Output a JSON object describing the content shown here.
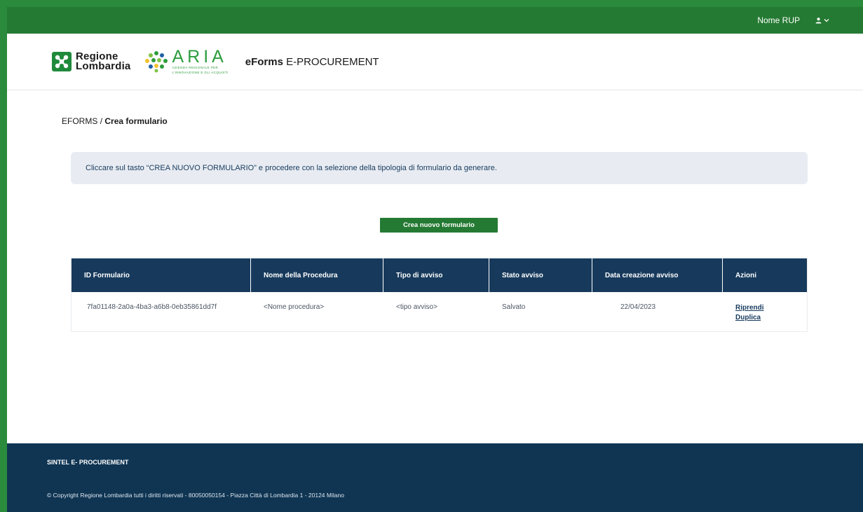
{
  "topbar": {
    "user_name": "Nome RUP",
    "user_icon": "user-icon",
    "menu_icon": "chevron-down-icon"
  },
  "header": {
    "logo_rl_line1": "Regione",
    "logo_rl_line2": "Lombardia",
    "logo_aria_word": "ARIA",
    "logo_aria_sub1": "AZIENDA REGIONALE PER",
    "logo_aria_sub2": "L'INNOVAZIONE E GLI ACQUISTI",
    "app_title_bold": "eForms",
    "app_title_rest": "E-PROCUREMENT"
  },
  "breadcrumb": {
    "root": "EFORMS",
    "separator": "/",
    "current": "Crea formulario"
  },
  "info": {
    "message": "Cliccare sul tasto “CREA NUOVO FORMULARIO” e procedere con la selezione della tipologia di formulario da generare."
  },
  "create_button": {
    "label": "Crea nuovo formulario"
  },
  "table": {
    "headers": [
      "ID Formulario",
      "Nome della Procedura",
      "Tipo di avviso",
      "Stato avviso",
      "Data creazione avviso",
      "Azioni"
    ],
    "rows": [
      {
        "id": "7fa01148-2a0a-4ba3-a6b8-0eb35861dd7f",
        "nome": "<Nome procedura>",
        "tipo": "<tipo avviso>",
        "stato": "Salvato",
        "data": "22/04/2023",
        "actions": [
          "Riprendi",
          "Duplica"
        ]
      }
    ]
  },
  "footer": {
    "title": "SINTEL E- PROCUREMENT",
    "copyright": "© Copyright Regione Lombardia tutti i diritti riservati - 80050050154 - Piazza Città di Lombardia 1 - 20124 Milano"
  },
  "colors": {
    "topbar": "#257a33",
    "table_header": "#173a5c",
    "footer": "#0f3553",
    "info_bg": "#e8ecf2"
  }
}
